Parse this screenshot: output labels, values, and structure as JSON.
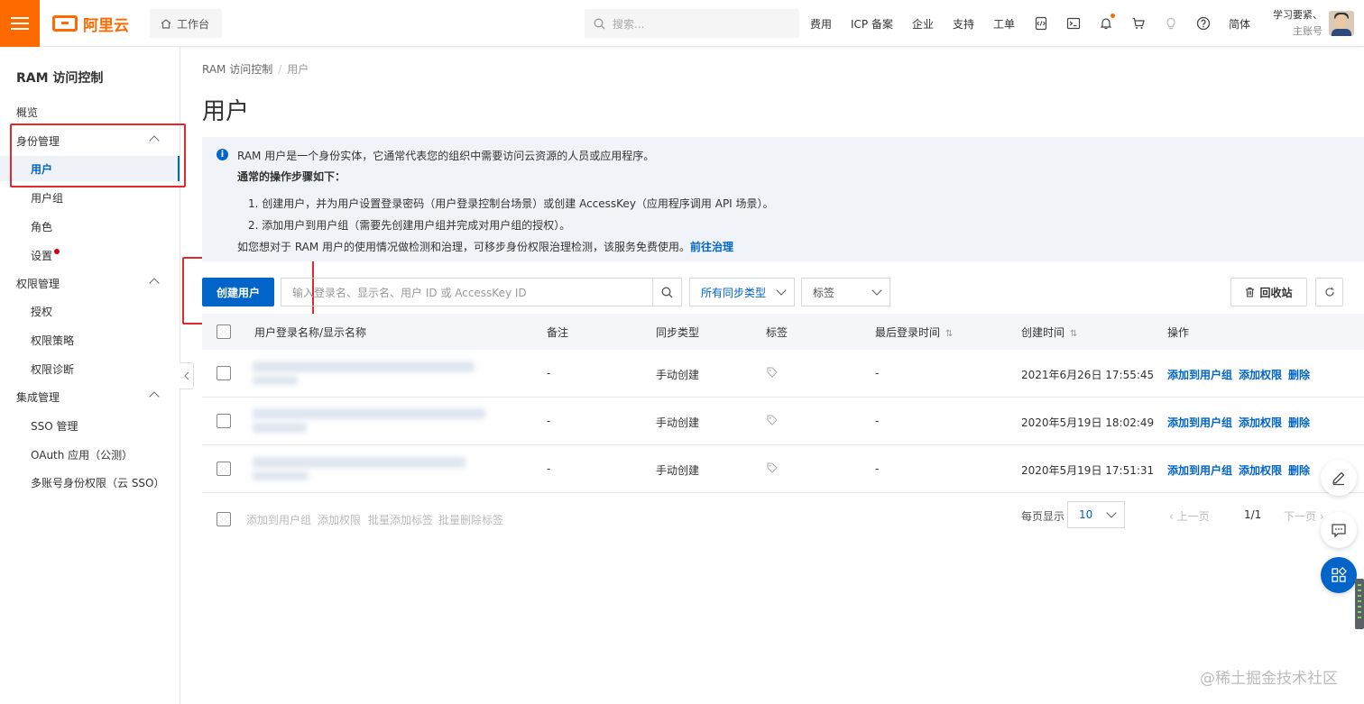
{
  "topbar": {
    "logo_text": "阿里云",
    "workbench_label": "工作台",
    "search_placeholder": "搜索...",
    "links": [
      "费用",
      "ICP 备案",
      "企业",
      "支持",
      "工单"
    ],
    "language": "简体",
    "user_name": "学习要紧、",
    "user_type": "主账号",
    "accent_color": "#ff6a00"
  },
  "sidebar": {
    "title": "RAM 访问控制",
    "overview": "概览",
    "identity_group": "身份管理",
    "identity_items": [
      "用户",
      "用户组",
      "角色",
      "设置"
    ],
    "permission_group": "权限管理",
    "permission_items": [
      "授权",
      "权限策略",
      "权限诊断"
    ],
    "integration_group": "集成管理",
    "integration_items": [
      "SSO 管理",
      "OAuth 应用（公测）",
      "多账号身份权限（云 SSO）"
    ]
  },
  "breadcrumb": {
    "root": "RAM 访问控制",
    "separator": "/",
    "current": "用户"
  },
  "page_title": "用户",
  "notice": {
    "line1": "RAM 用户是一个身份实体，它通常代表您的组织中需要访问云资源的人员或应用程序。",
    "line2": "通常的操作步骤如下：",
    "step1": "1. 创建用户，并为用户设置登录密码（用户登录控制台场景）或创建 AccessKey（应用程序调用 API 场景）。",
    "step2": "2. 添加用户到用户组（需要先创建用户组并完成对用户组的授权）。",
    "line5": "如您想对于 RAM 用户的使用情况做检测和治理，可移步身份权限治理检测，该服务免费使用。",
    "link": "前往治理"
  },
  "toolbar": {
    "create_button": "创建用户",
    "search_placeholder": "输入登录名、显示名、用户 ID 或 AccessKey ID",
    "sync_select": "所有同步类型",
    "tag_select": "标签",
    "recycle_button": "回收站"
  },
  "table": {
    "headers": [
      "用户登录名称/显示名称",
      "备注",
      "同步类型",
      "标签",
      "最后登录时间",
      "创建时间",
      "操作"
    ],
    "rows": [
      {
        "remark": "-",
        "sync": "手动创建",
        "last_login": "-",
        "created": "2021年6月26日 17:55:45"
      },
      {
        "remark": "-",
        "sync": "手动创建",
        "last_login": "-",
        "created": "2020年5月19日 18:02:49"
      },
      {
        "remark": "-",
        "sync": "手动创建",
        "last_login": "-",
        "created": "2020年5月19日 17:51:31"
      }
    ],
    "ops": [
      "添加到用户组",
      "添加权限",
      "删除"
    ]
  },
  "footer": {
    "batch_actions": [
      "添加到用户组",
      "添加权限",
      "批量添加标签",
      "批量删除标签"
    ],
    "page_size_label": "每页显示",
    "page_size": "10",
    "prev": "上一页",
    "page_info": "1/1",
    "next": "下一页"
  },
  "watermark": "@稀土掘金技术社区"
}
